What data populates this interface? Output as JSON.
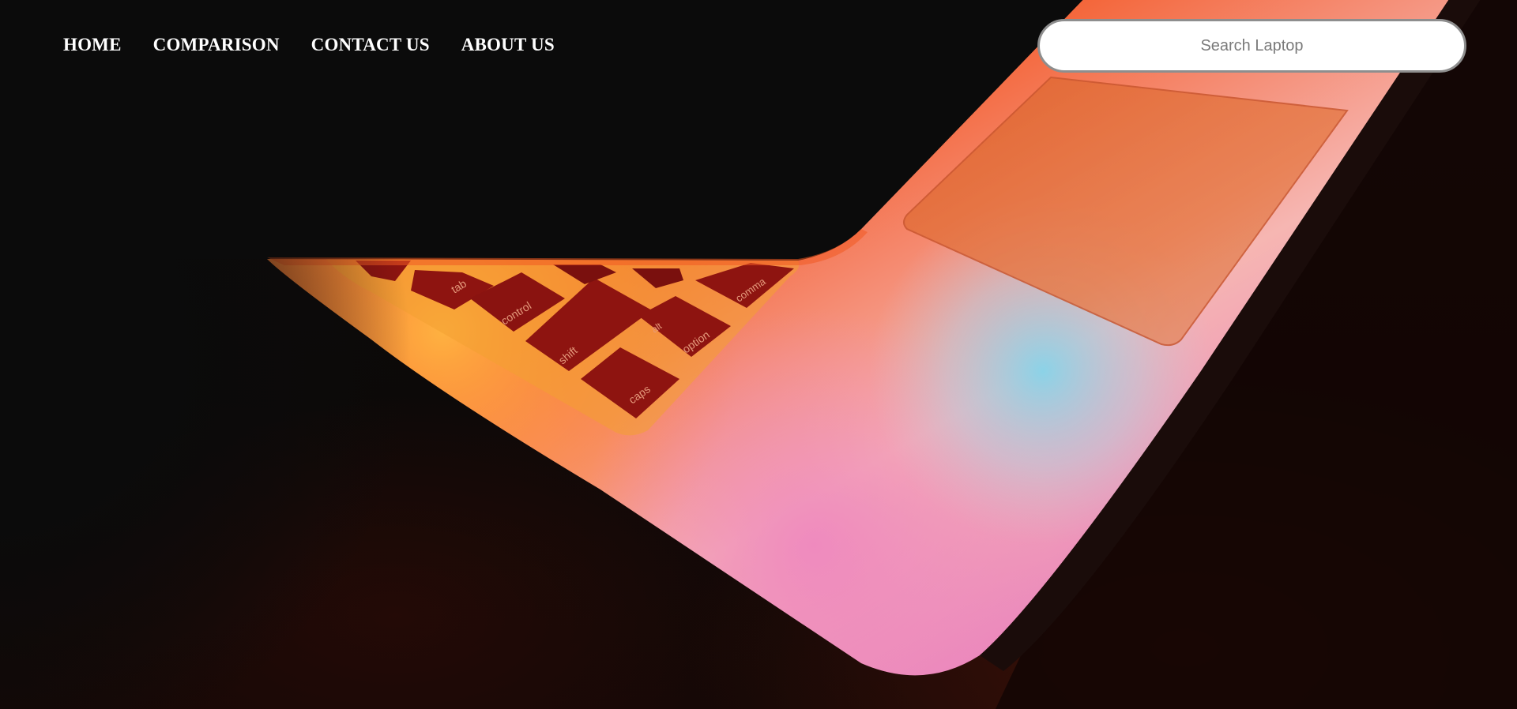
{
  "nav": {
    "items": [
      {
        "label": "HOME"
      },
      {
        "label": "COMPARISON"
      },
      {
        "label": "CONTACT US"
      },
      {
        "label": "ABOUT US"
      }
    ]
  },
  "search": {
    "placeholder": "Search Laptop",
    "value": ""
  },
  "hero": {
    "keys": [
      "tab",
      "control",
      "shift",
      "alt",
      "option",
      "caps",
      "comma"
    ]
  },
  "colors": {
    "nav_text": "#ffffff",
    "page_bg": "#0b0b0b",
    "laptop_orange": "#f0582a",
    "laptop_pink": "#e98fc2",
    "laptop_blue": "#8ccfe3",
    "key_red": "#8e1410"
  }
}
